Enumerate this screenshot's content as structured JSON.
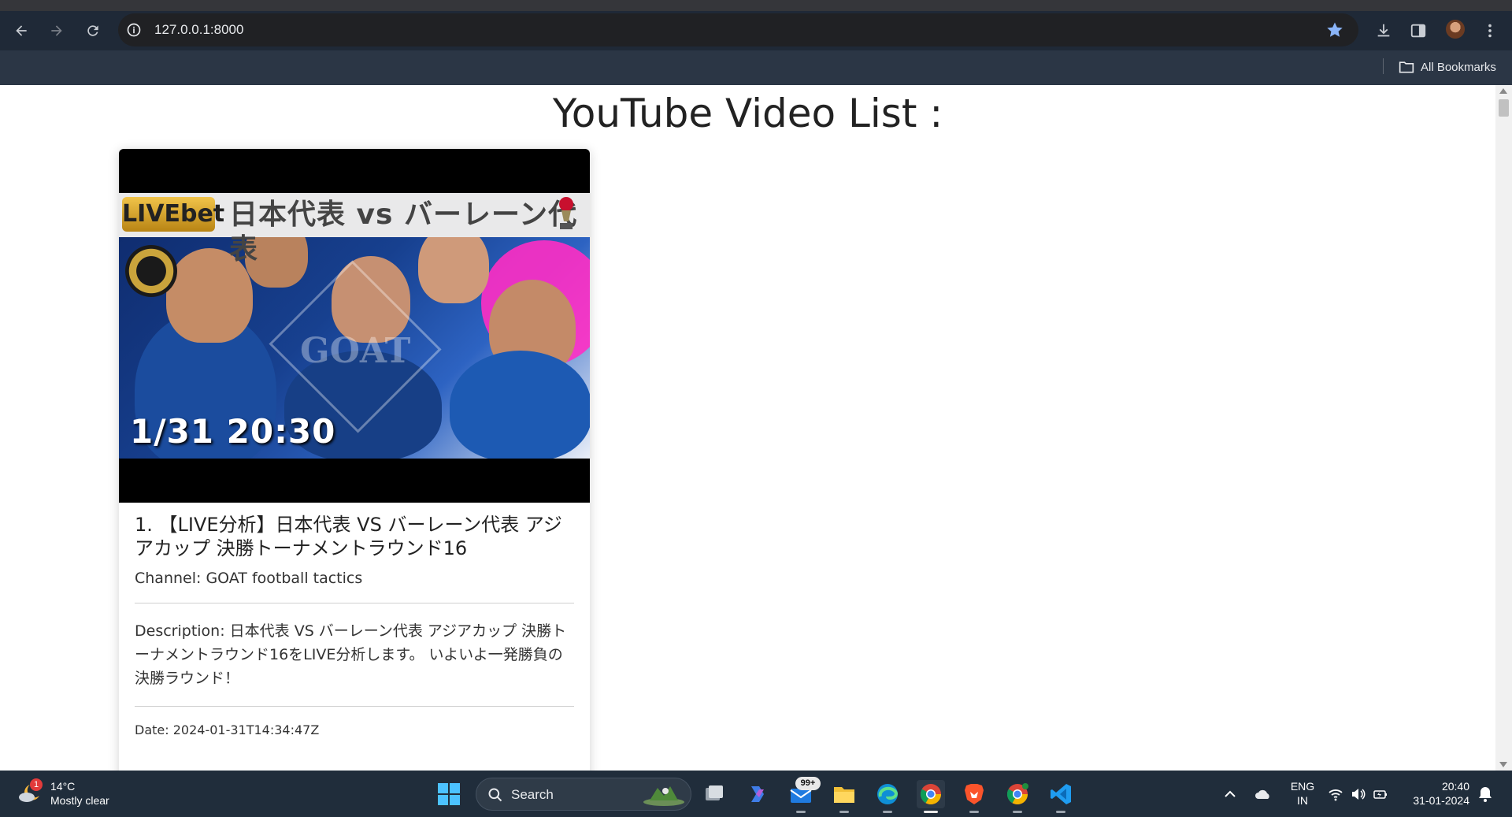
{
  "browser": {
    "url": "127.0.0.1:8000",
    "bookmarks_label": "All Bookmarks"
  },
  "page": {
    "title": "YouTube Video List :"
  },
  "videos": [
    {
      "thumbnail": {
        "brand": "LIVEbet",
        "headline": "日本代表 vs バーレーン代表",
        "time": "1/31 20:30",
        "watermark": "GOAT"
      },
      "title": "1. 【LIVE分析】日本代表 VS バーレーン代表 アジアカップ 決勝トーナメントラウンド16",
      "channel": "Channel: GOAT football tactics",
      "description": "Description: 日本代表 VS バーレーン代表 アジアカップ 決勝トーナメントラウンド16をLIVE分析します。 いよいよ一発勝負の決勝ラウンド！",
      "date": "Date: 2024-01-31T14:34:47Z"
    }
  ],
  "taskbar": {
    "weather_temp": "14°C",
    "weather_desc": "Mostly clear",
    "weather_badge": "1",
    "search_label": "Search",
    "mail_badge": "99+",
    "lang_line1": "ENG",
    "lang_line2": "IN",
    "time": "20:40",
    "date": "31-01-2024"
  },
  "colors": {
    "accent_star": "#8ab4f8",
    "chrome_toolbar": "#1f2937",
    "taskbar": "#202d3b"
  }
}
